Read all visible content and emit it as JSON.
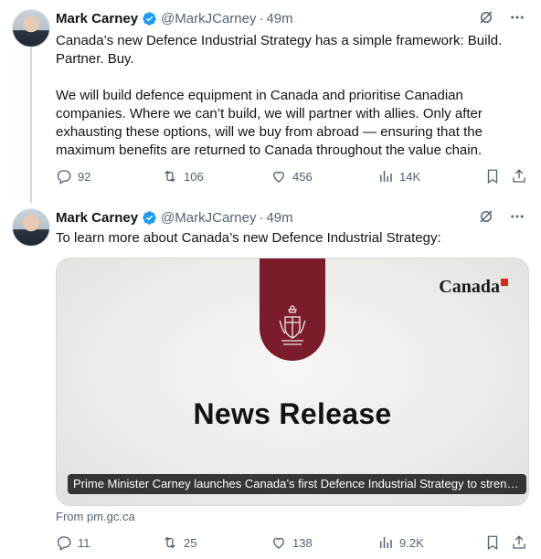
{
  "tweets": [
    {
      "author": {
        "name": "Mark Carney",
        "handle": "@MarkJCarney",
        "time": "49m"
      },
      "text": [
        "Canada’s new Defence Industrial Strategy has a simple framework: Build. Partner. Buy.",
        "We will build defence equipment in Canada and prioritise Canadian companies. Where we can’t build, we will partner with allies. Only after exhausting these options, will we buy from abroad — ensuring that the maximum benefits are returned to Canada throughout the value chain."
      ],
      "stats": {
        "replies": "92",
        "reposts": "106",
        "likes": "456",
        "views": "14K"
      }
    },
    {
      "author": {
        "name": "Mark Carney",
        "handle": "@MarkJCarney",
        "time": "49m"
      },
      "text": [
        "To learn more about Canada’s new Defence Industrial Strategy:"
      ],
      "card": {
        "headline": "News Release",
        "wordmark": "Canada",
        "caption": "Prime Minister Carney launches Canada’s first Defence Industrial Strategy to strengthen",
        "source": "From pm.gc.ca",
        "ribbon_color": "#7a1c2a"
      },
      "stats": {
        "replies": "11",
        "reposts": "25",
        "likes": "138",
        "views": "9.2K"
      }
    }
  ],
  "icons": {
    "verified": "verified-badge-icon",
    "grok": "grok-icon",
    "more": "more-icon",
    "reply": "reply-icon",
    "repost": "repost-icon",
    "like": "like-icon",
    "views": "views-icon",
    "bookmark": "bookmark-icon",
    "share": "share-icon"
  },
  "colors": {
    "verified": "#1d9bf0",
    "muted": "#536471",
    "text": "#0f1419"
  }
}
